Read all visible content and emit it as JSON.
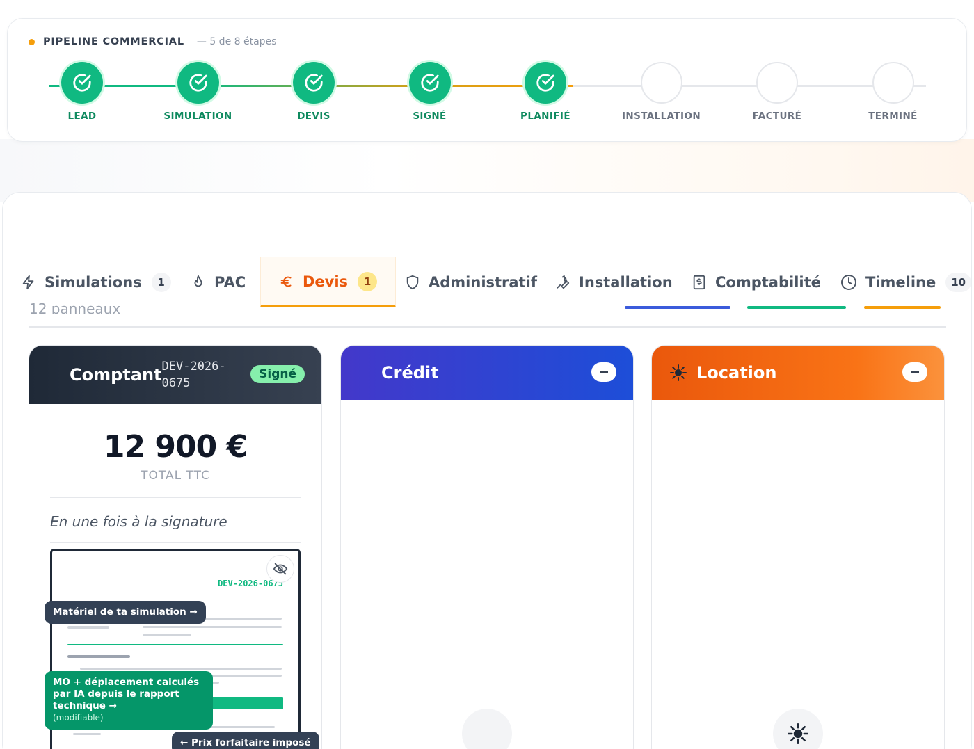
{
  "pipeline": {
    "title": "PIPELINE COMMERCIAL",
    "progress": "— 5 de 8 étapes",
    "completed": 5,
    "total": 8,
    "steps": [
      {
        "label": "LEAD",
        "done": true
      },
      {
        "label": "SIMULATION",
        "done": true
      },
      {
        "label": "DEVIS",
        "done": true
      },
      {
        "label": "SIGNÉ",
        "done": true
      },
      {
        "label": "PLANIFIÉ",
        "done": true
      },
      {
        "label": "INSTALLATION",
        "done": false
      },
      {
        "label": "FACTURÉ",
        "done": false
      },
      {
        "label": "TERMINÉ",
        "done": false
      }
    ]
  },
  "tabs": [
    {
      "label": "Simulations",
      "icon": "bolt-icon",
      "badge": "1"
    },
    {
      "label": "PAC",
      "icon": "flame-icon"
    },
    {
      "label": "Devis",
      "icon": "euro-icon",
      "badge": "1",
      "active": true
    },
    {
      "label": "Administratif",
      "icon": "shield-icon"
    },
    {
      "label": "Installation",
      "icon": "wrench-icon"
    },
    {
      "label": "Comptabilité",
      "icon": "receipt-icon"
    },
    {
      "label": "Timeline",
      "icon": "clock-icon",
      "badge": "10"
    }
  ],
  "ghost_text": "12 panneaux",
  "cards": {
    "cash": {
      "title": "Comptant",
      "ref": "DEV-2026-0675",
      "status": "Signé",
      "amount": "12 900 €",
      "amount_label": "TOTAL TTC",
      "payment_note": "En une fois à la signature",
      "preview_ref": "DEV-2026-0675",
      "tip_material": "Matériel de ta simulation →",
      "tip_labor": "MO + déplacement calculés par IA depuis le rapport technique →",
      "tip_labor_note": "(modifiable)",
      "tip_price": "← Prix forfaitaire imposé"
    },
    "credit": {
      "title": "Crédit"
    },
    "rental": {
      "title": "Location",
      "icon": "sun-icon"
    }
  },
  "colors": {
    "accent_green": "#10b981",
    "accent_orange": "#f59e0b",
    "credit_blue": "#4338ca",
    "rental_orange": "#ea580c"
  }
}
